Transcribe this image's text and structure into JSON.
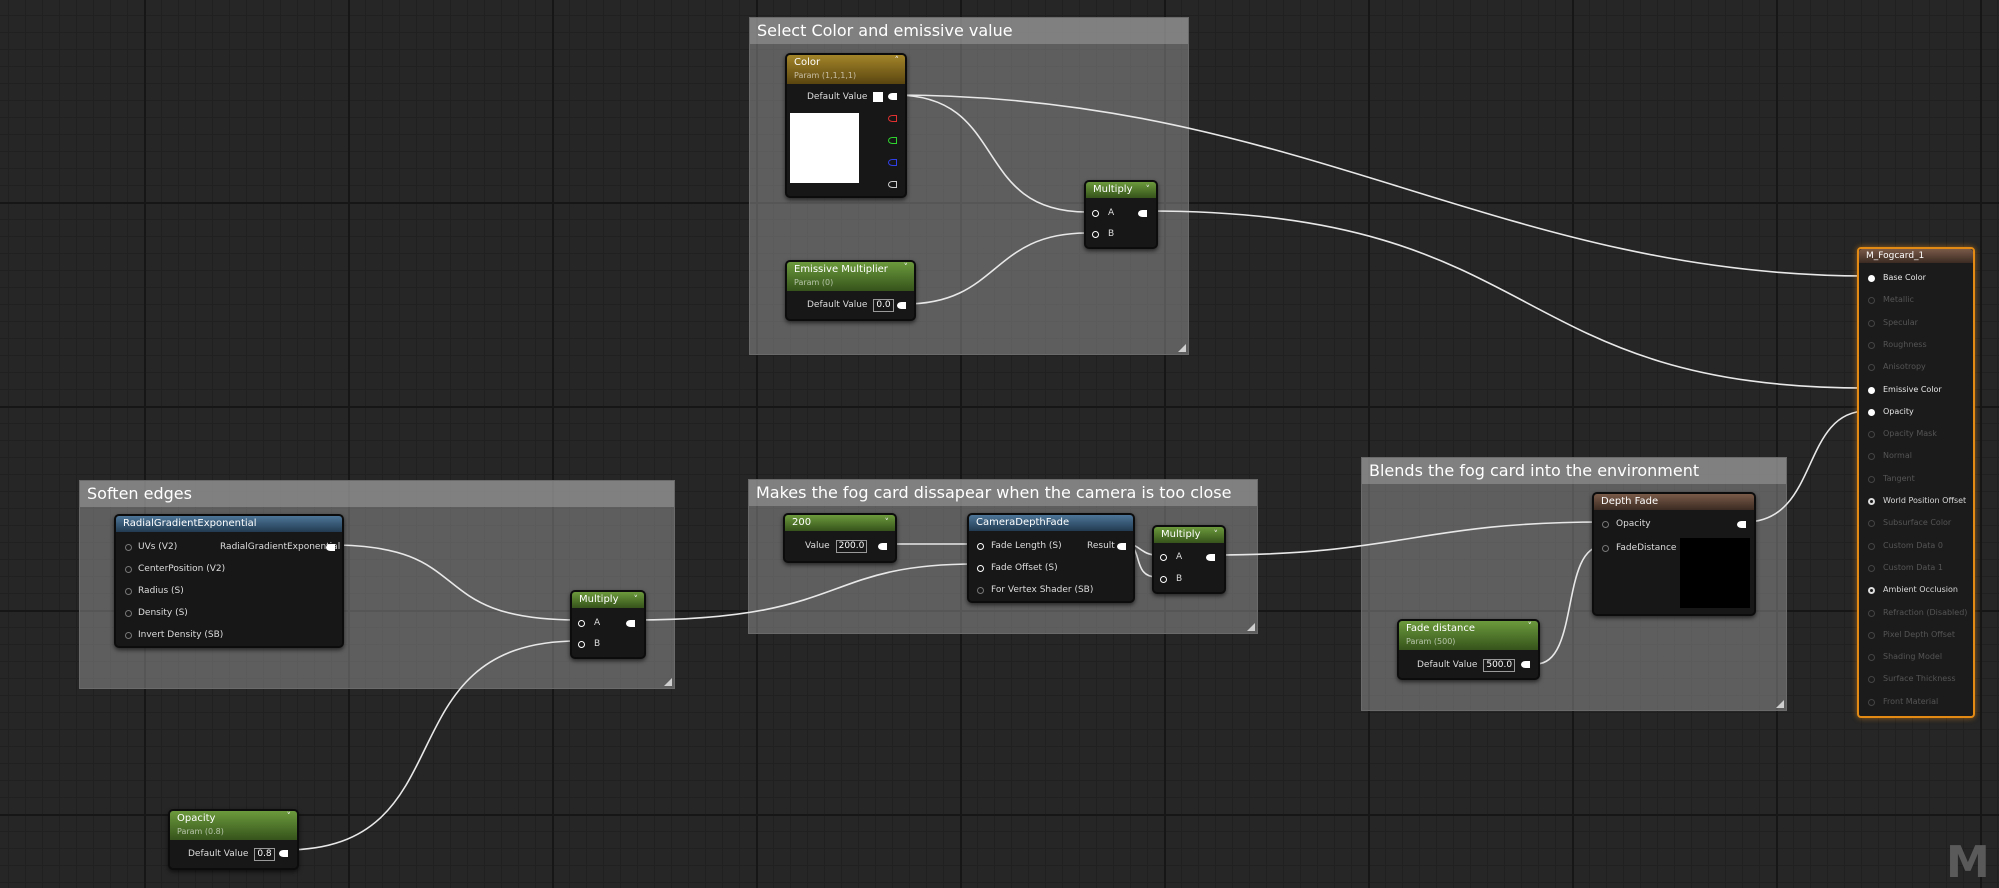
{
  "comments": {
    "color": "Select Color and emissive value",
    "soften": "Soften edges",
    "fade": "Makes the fog card dissapear when the camera is too close",
    "blend": "Blends the fog card into the environment"
  },
  "color_param": {
    "title": "Color",
    "subtitle": "Param (1,1,1,1)",
    "default_label": "Default Value"
  },
  "emissive_param": {
    "title": "Emissive Multiplier",
    "subtitle": "Param (0)",
    "default_label": "Default Value",
    "default_value": "0.0"
  },
  "multiply_label": "Multiply",
  "pin_a": "A",
  "pin_b": "B",
  "radial": {
    "title": "RadialGradientExponential",
    "inputs": [
      "UVs (V2)",
      "CenterPosition (V2)",
      "Radius (S)",
      "Density (S)",
      "Invert Density (SB)"
    ],
    "output": "RadialGradientExponential"
  },
  "const_200": {
    "title": "200",
    "value_label": "Value",
    "value": "200.0"
  },
  "camera_depth_fade": {
    "title": "CameraDepthFade",
    "inputs": [
      "Fade Length (S)",
      "Fade Offset (S)",
      "For Vertex Shader (SB)"
    ],
    "output": "Result"
  },
  "opacity_param": {
    "title": "Opacity",
    "subtitle": "Param (0.8)",
    "default_label": "Default Value",
    "default_value": "0.8"
  },
  "depth_fade": {
    "title": "Depth Fade",
    "inputs": [
      "Opacity",
      "FadeDistance"
    ]
  },
  "fade_distance_param": {
    "title": "Fade distance",
    "subtitle": "Param (500)",
    "default_label": "Default Value",
    "default_value": "500.0"
  },
  "material": {
    "title": "M_Fogcard_1",
    "pins": [
      {
        "label": "Base Color",
        "state": "on"
      },
      {
        "label": "Metallic",
        "state": "off"
      },
      {
        "label": "Specular",
        "state": "off"
      },
      {
        "label": "Roughness",
        "state": "off"
      },
      {
        "label": "Anisotropy",
        "state": "off"
      },
      {
        "label": "Emissive Color",
        "state": "on"
      },
      {
        "label": "Opacity",
        "state": "on"
      },
      {
        "label": "Opacity Mask",
        "state": "off"
      },
      {
        "label": "Normal",
        "state": "off"
      },
      {
        "label": "Tangent",
        "state": "off"
      },
      {
        "label": "World Position Offset",
        "state": "ring"
      },
      {
        "label": "Subsurface Color",
        "state": "off"
      },
      {
        "label": "Custom Data 0",
        "state": "off"
      },
      {
        "label": "Custom Data 1",
        "state": "off"
      },
      {
        "label": "Ambient Occlusion",
        "state": "ring"
      },
      {
        "label": "Refraction (Disabled)",
        "state": "off"
      },
      {
        "label": "Pixel Depth Offset",
        "state": "off"
      },
      {
        "label": "Shading Model",
        "state": "off"
      },
      {
        "label": "Surface Thickness",
        "state": "off"
      },
      {
        "label": "Front Material",
        "state": "off"
      }
    ]
  },
  "watermark": "M",
  "colors": {
    "background": "#262626",
    "selection": "#e28a14",
    "wire": "#e8e8e8",
    "param_header": "#5e8a34",
    "color_header": "#9c7d22",
    "function_header": "#3f6585"
  }
}
